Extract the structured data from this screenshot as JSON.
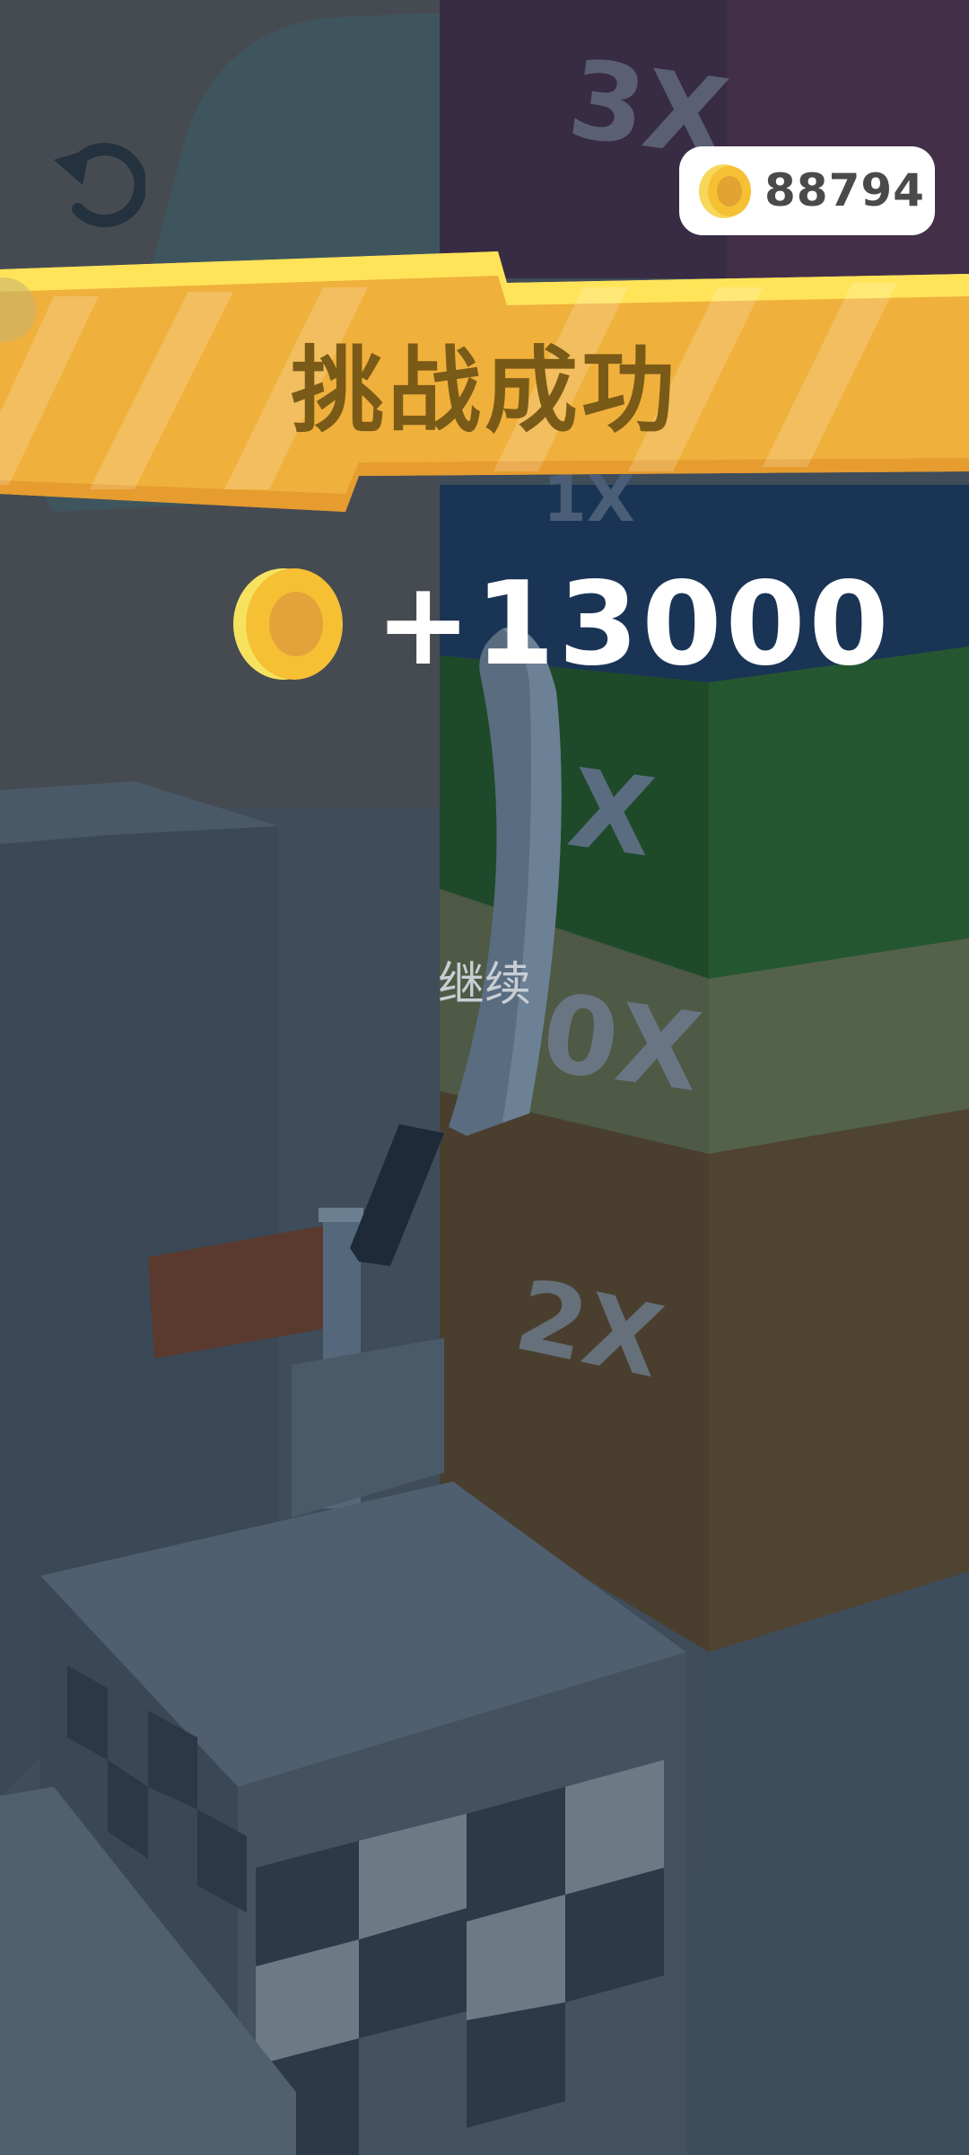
{
  "hud": {
    "coin_total": "88794",
    "restart_icon": "restart-icon",
    "coin_icon": "coin-icon"
  },
  "banner": {
    "title": "挑战成功"
  },
  "reward": {
    "amount": "+13000"
  },
  "actions": {
    "continue_label": "继续"
  },
  "multiplier_blocks": [
    "3X",
    "1X",
    "X",
    "0X",
    "2X"
  ],
  "colors": {
    "banner": "#f2b23c",
    "banner_edge": "#ffe45a",
    "coin": "#f5c033",
    "block_top": "#3a2c45",
    "block_blue": "#1b3a5e",
    "block_green": "#22502d",
    "block_olive": "#4f5b47",
    "block_brown": "#4b4030"
  }
}
